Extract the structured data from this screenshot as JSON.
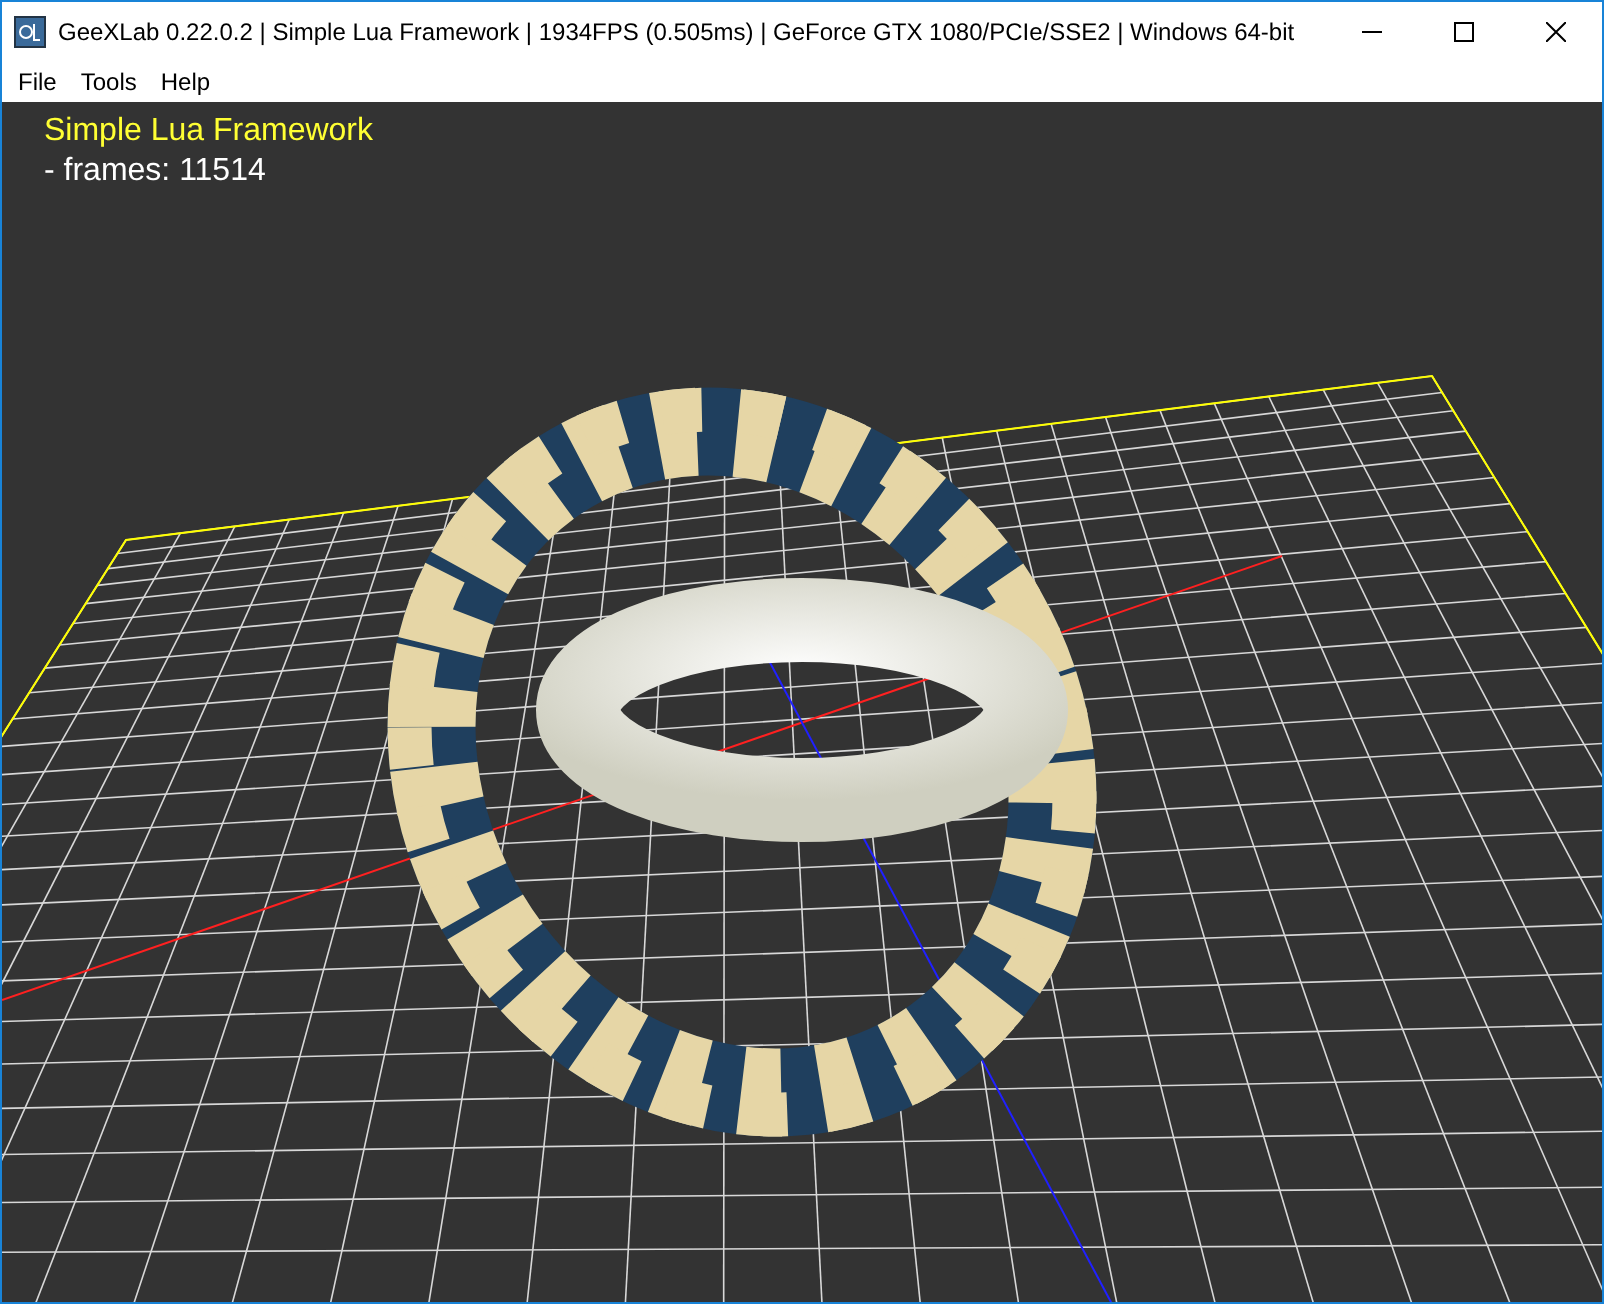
{
  "window": {
    "title": "GeeXLab 0.22.0.2 | Simple Lua Framework | 1934FPS (0.505ms) | GeForce GTX 1080/PCIe/SSE2 | Windows 64-bit"
  },
  "menu": [
    "File",
    "Tools",
    "Help"
  ],
  "overlay": {
    "title": "Simple Lua Framework",
    "stats": "- frames: 11514"
  }
}
